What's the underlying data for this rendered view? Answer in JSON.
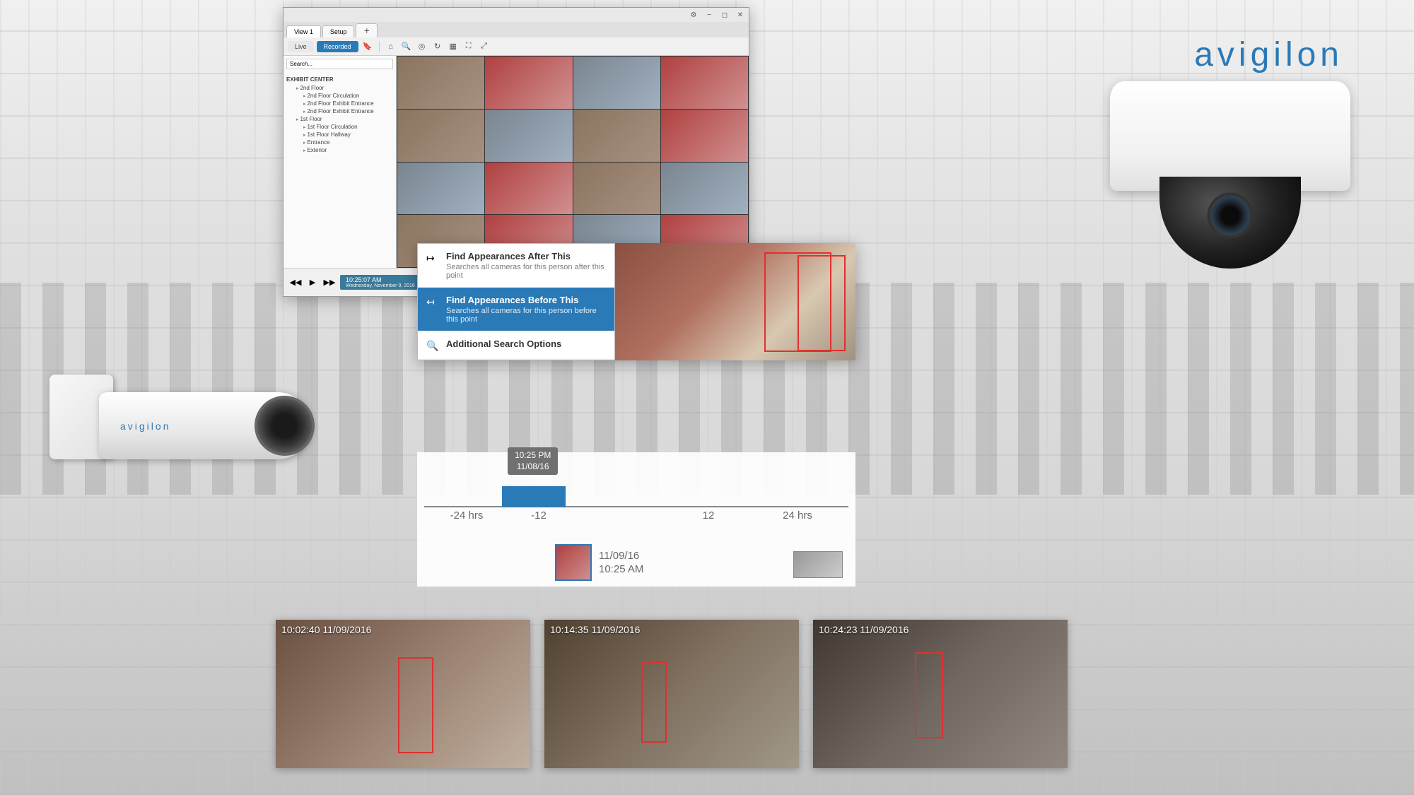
{
  "brand": "avigilon",
  "vms": {
    "tabs": {
      "view": "View 1",
      "setup": "Setup"
    },
    "modes": {
      "live": "Live",
      "recorded": "Recorded"
    },
    "search_placeholder": "Search...",
    "tree": {
      "root": "EXHIBIT CENTER",
      "items": [
        "2nd Floor",
        "2nd Floor Circulation",
        "2nd Floor Exhibit Entrance",
        "2nd Floor Exhibit Entrance",
        "1st Floor",
        "1st Floor Circulation",
        "1st Floor Hallway",
        "Entrance",
        "Exterior"
      ]
    },
    "playback": {
      "time": "10:25:07 AM",
      "date_label": "Wednesday, November 9, 2016",
      "range_date": "Wednesday, November 9, 2016"
    }
  },
  "context_menu": {
    "items": [
      {
        "icon": "↦",
        "title": "Find Appearances After This",
        "desc": "Searches all cameras for this person after this point"
      },
      {
        "icon": "↤",
        "title": "Find Appearances Before This",
        "desc": "Searches all cameras for this person before this point"
      },
      {
        "icon": "🔍",
        "title": "Additional Search Options",
        "desc": ""
      }
    ],
    "selected_index": 1
  },
  "timeline": {
    "anchor": {
      "time": "10:25 PM",
      "date": "11/08/16"
    },
    "ticks": [
      "-24 hrs",
      "-12",
      "12",
      "24 hrs"
    ],
    "result": {
      "date": "11/09/16",
      "time": "10:25 AM"
    }
  },
  "results": [
    {
      "stamp": "10:02:40  11/09/2016"
    },
    {
      "stamp": "10:14:35  11/09/2016"
    },
    {
      "stamp": "10:24:23  11/09/2016"
    }
  ],
  "bullet_cam_brand": "avigilon"
}
